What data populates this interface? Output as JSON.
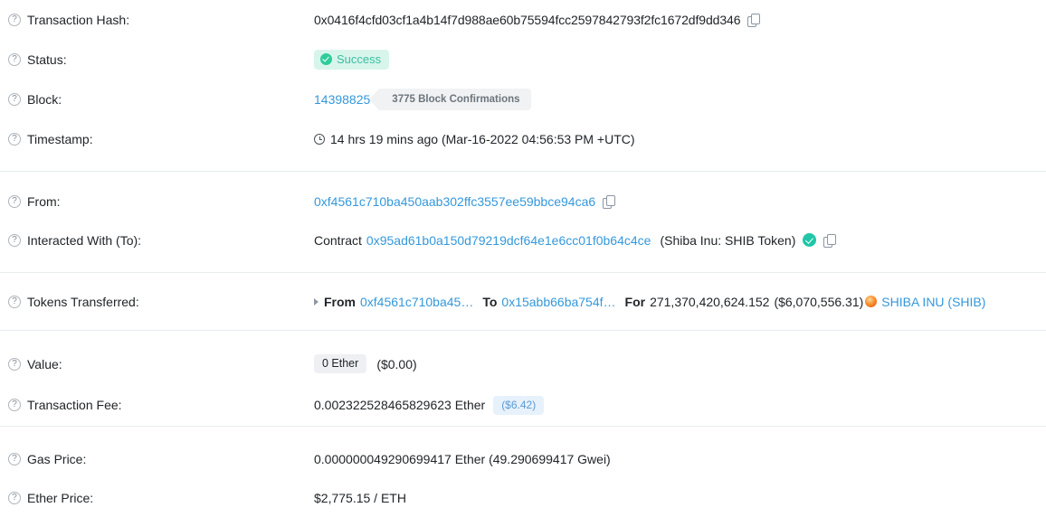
{
  "rows": {
    "transaction_hash": {
      "label": "Transaction Hash:",
      "value": "0x0416f4cfd03cf1a4b14f7d988ae60b75594fcc2597842793f2fc1672df9dd346",
      "copy_icon": "copy-icon",
      "help_icon": "?"
    },
    "status": {
      "label": "Status:",
      "badge": "Success",
      "badge_bg": "#d8f5ec",
      "badge_color": "#39c0a0"
    },
    "block": {
      "label": "Block:",
      "number": "14398825",
      "confirmations": "3775 Block Confirmations"
    },
    "timestamp": {
      "label": "Timestamp:",
      "value": "14 hrs 19 mins ago (Mar-16-2022 04:56:53 PM +UTC)"
    },
    "from": {
      "label": "From:",
      "address": "0xf4561c710ba450aab302ffc3557ee59bbce94ca6"
    },
    "interacted_with": {
      "label": "Interacted With (To):",
      "prefix": "Contract",
      "address": "0x95ad61b0a150d79219dcf64e1e6cc01f0b64c4ce",
      "token_name": "(Shiba Inu: SHIB Token)"
    },
    "tokens_transferred": {
      "label": "Tokens Transferred:",
      "from_kw": "From",
      "from_address": "0xf4561c710ba45…",
      "to_kw": "To",
      "to_address": "0x15abb66ba754f…",
      "for_kw": "For",
      "amount": "271,370,420,624.152",
      "usd": "($6,070,556.31)",
      "token": "SHIBA INU (SHIB)"
    },
    "value": {
      "label": "Value:",
      "ether": "0 Ether",
      "usd": "($0.00)"
    },
    "transaction_fee": {
      "label": "Transaction Fee:",
      "ether": "0.002322528465829623 Ether",
      "usd": "($6.42)"
    },
    "gas_price": {
      "label": "Gas Price:",
      "value": "0.000000049290699417 Ether (49.290699417 Gwei)"
    },
    "ether_price": {
      "label": "Ether Price:",
      "value": "$2,775.15 / ETH"
    }
  },
  "icons": {
    "help": "?",
    "copy": "copy-icon",
    "clock": "clock-icon",
    "verified": "verified-check-icon",
    "caret": "caret-right-icon",
    "token": "shib-token-icon"
  },
  "colors": {
    "link": "#3498db",
    "success": "#2ecc9b",
    "divider": "#e9ecef",
    "text": "#212529"
  }
}
